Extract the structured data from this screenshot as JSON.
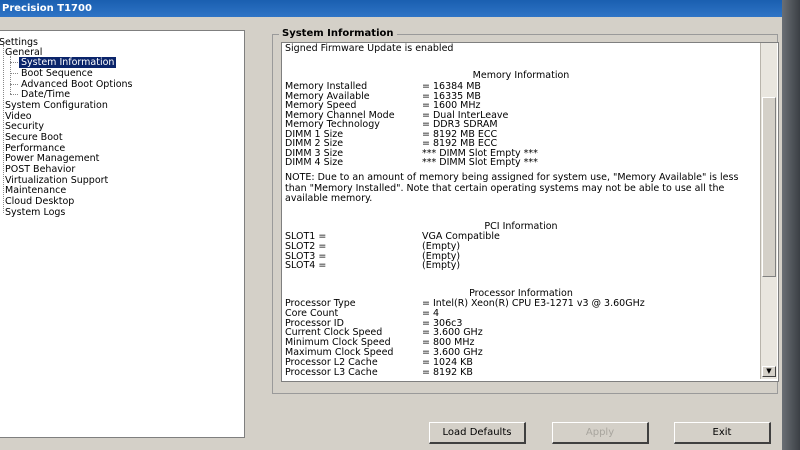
{
  "window": {
    "title": "Precision T1700"
  },
  "tree": {
    "items": [
      {
        "label": "Settings",
        "level": 1
      },
      {
        "label": "General",
        "level": 2
      },
      {
        "label": "System Information",
        "level": 3,
        "selected": true
      },
      {
        "label": "Boot Sequence",
        "level": 3
      },
      {
        "label": "Advanced Boot Options",
        "level": 3
      },
      {
        "label": "Date/Time",
        "level": 3
      },
      {
        "label": "System Configuration",
        "level": 2
      },
      {
        "label": "Video",
        "level": 2
      },
      {
        "label": "Security",
        "level": 2
      },
      {
        "label": "Secure Boot",
        "level": 2
      },
      {
        "label": "Performance",
        "level": 2
      },
      {
        "label": "Power Management",
        "level": 2
      },
      {
        "label": "POST Behavior",
        "level": 2
      },
      {
        "label": "Virtualization Support",
        "level": 2
      },
      {
        "label": "Maintenance",
        "level": 2
      },
      {
        "label": "Cloud Desktop",
        "level": 2
      },
      {
        "label": "System Logs",
        "level": 2
      }
    ]
  },
  "panel": {
    "title": "System Information",
    "firmware_note": "Signed Firmware Update is enabled",
    "memory": {
      "heading": "Memory Information",
      "rows": [
        {
          "label": "Memory Installed",
          "value": "= 16384 MB"
        },
        {
          "label": "Memory Available",
          "value": "= 16335 MB"
        },
        {
          "label": "Memory Speed",
          "value": "= 1600 MHz"
        },
        {
          "label": "Memory Channel Mode",
          "value": "= Dual InterLeave"
        },
        {
          "label": "Memory Technology",
          "value": "= DDR3 SDRAM"
        },
        {
          "label": "DIMM 1 Size",
          "value": "= 8192 MB ECC"
        },
        {
          "label": "DIMM 2 Size",
          "value": "= 8192 MB ECC"
        },
        {
          "label": "DIMM 3 Size",
          "value": "*** DIMM Slot Empty ***"
        },
        {
          "label": "DIMM 4 Size",
          "value": "*** DIMM Slot Empty ***"
        }
      ],
      "note": "NOTE: Due to an amount of memory being assigned for system use, \"Memory Available\" is less than \"Memory Installed\". Note that certain operating systems may not be able to use all the available memory."
    },
    "pci": {
      "heading": "PCI Information",
      "rows": [
        {
          "label": "SLOT1 =",
          "value": "VGA Compatible"
        },
        {
          "label": "SLOT2 =",
          "value": "(Empty)"
        },
        {
          "label": "SLOT3 =",
          "value": "(Empty)"
        },
        {
          "label": "SLOT4 =",
          "value": "(Empty)"
        }
      ]
    },
    "processor": {
      "heading": "Processor Information",
      "rows": [
        {
          "label": "Processor Type",
          "value": "= Intel(R) Xeon(R) CPU E3-1271 v3 @ 3.60GHz"
        },
        {
          "label": "Core Count",
          "value": "= 4"
        },
        {
          "label": "Processor ID",
          "value": "= 306c3"
        },
        {
          "label": "Current Clock Speed",
          "value": "= 3.600 GHz"
        },
        {
          "label": "Minimum Clock Speed",
          "value": "= 800 MHz"
        },
        {
          "label": "Maximum Clock Speed",
          "value": "= 3.600 GHz"
        },
        {
          "label": "Processor L2 Cache",
          "value": "= 1024 KB"
        },
        {
          "label": "Processor L3 Cache",
          "value": "= 8192 KB"
        }
      ]
    }
  },
  "buttons": {
    "load_defaults": "Load Defaults",
    "apply": "Apply",
    "exit": "Exit"
  },
  "colors": {
    "titlebar": "#1a5fb0",
    "selection": "#0a246a",
    "face": "#d4d0c8"
  }
}
